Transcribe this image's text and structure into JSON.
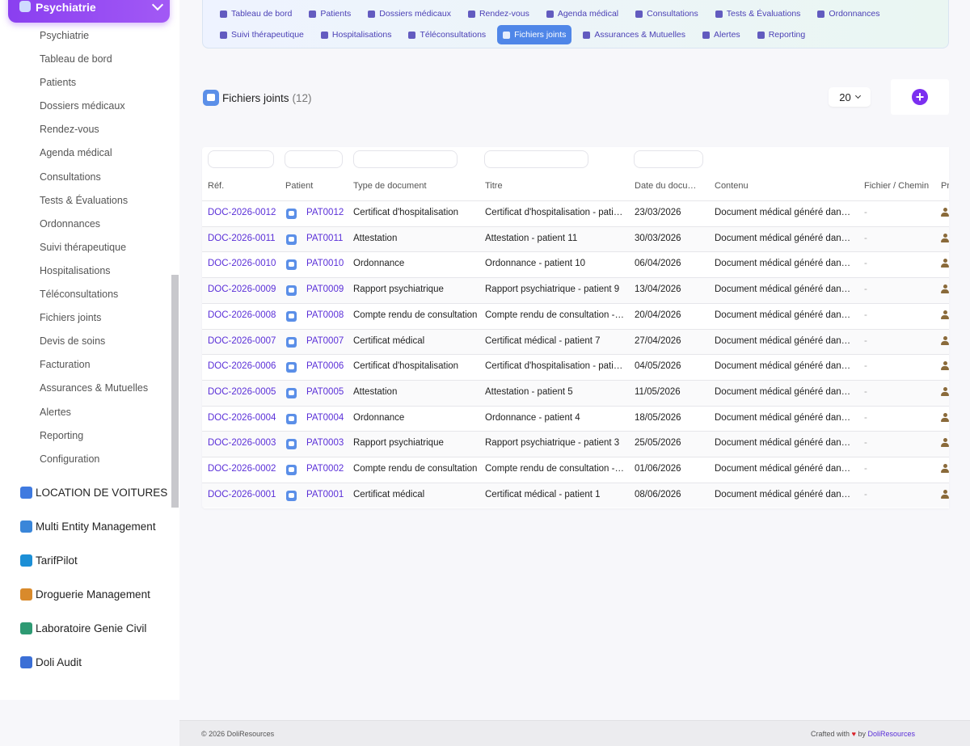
{
  "sidebar": {
    "module_title": "Psychiatrie",
    "items": [
      "Psychiatrie",
      "Tableau de bord",
      "Patients",
      "Dossiers médicaux",
      "Rendez-vous",
      "Agenda médical",
      "Consultations",
      "Tests & Évaluations",
      "Ordonnances",
      "Suivi thérapeutique",
      "Hospitalisations",
      "Téléconsultations",
      "Fichiers joints",
      "Devis de soins",
      "Facturation",
      "Assurances & Mutuelles",
      "Alertes",
      "Reporting",
      "Configuration"
    ],
    "other_modules": [
      {
        "label": "LOCATION DE VOITURES",
        "color": "#3f7ae0"
      },
      {
        "label": "Multi Entity Management",
        "color": "#3a86d9"
      },
      {
        "label": "TarifPilot",
        "color": "#1c8fd6"
      },
      {
        "label": "Droguerie Management",
        "color": "#d98a2b"
      },
      {
        "label": "Laboratoire Genie Civil",
        "color": "#2e9a73"
      },
      {
        "label": "Doli Audit",
        "color": "#3b6fd6"
      }
    ]
  },
  "topnav": {
    "row1": [
      "Tableau de bord",
      "Patients",
      "Dossiers médicaux",
      "Rendez-vous",
      "Agenda médical",
      "Consultations",
      "Tests & Évaluations",
      "Ordonnances"
    ],
    "row2": [
      "Suivi thérapeutique",
      "Hospitalisations",
      "Téléconsultations",
      "Fichiers joints",
      "Assurances & Mutuelles",
      "Alertes",
      "Reporting"
    ],
    "active": "Fichiers joints"
  },
  "page": {
    "title": "Fichiers joints",
    "count": "(12)",
    "per_page": "20"
  },
  "table": {
    "columns": [
      "Réf.",
      "Patient",
      "Type de document",
      "Titre",
      "Date du docu…",
      "Contenu",
      "Fichier / Chemin",
      "Pr"
    ],
    "rows": [
      {
        "ref": "DOC-2026-0012",
        "patient": "PAT0012",
        "type": "Certificat d'hospitalisation",
        "title": "Certificat d'hospitalisation - patie…",
        "date": "23/03/2026",
        "content": "Document médical généré dans…",
        "file": "-"
      },
      {
        "ref": "DOC-2026-0011",
        "patient": "PAT0011",
        "type": "Attestation",
        "title": "Attestation - patient 11",
        "date": "30/03/2026",
        "content": "Document médical généré dans…",
        "file": "-"
      },
      {
        "ref": "DOC-2026-0010",
        "patient": "PAT0010",
        "type": "Ordonnance",
        "title": "Ordonnance - patient 10",
        "date": "06/04/2026",
        "content": "Document médical généré dans…",
        "file": "-"
      },
      {
        "ref": "DOC-2026-0009",
        "patient": "PAT0009",
        "type": "Rapport psychiatrique",
        "title": "Rapport psychiatrique - patient 9",
        "date": "13/04/2026",
        "content": "Document médical généré dans…",
        "file": "-"
      },
      {
        "ref": "DOC-2026-0008",
        "patient": "PAT0008",
        "type": "Compte rendu de consultation",
        "title": "Compte rendu de consultation - …",
        "date": "20/04/2026",
        "content": "Document médical généré dans…",
        "file": "-"
      },
      {
        "ref": "DOC-2026-0007",
        "patient": "PAT0007",
        "type": "Certificat médical",
        "title": "Certificat médical - patient 7",
        "date": "27/04/2026",
        "content": "Document médical généré dans…",
        "file": "-"
      },
      {
        "ref": "DOC-2026-0006",
        "patient": "PAT0006",
        "type": "Certificat d'hospitalisation",
        "title": "Certificat d'hospitalisation - patie…",
        "date": "04/05/2026",
        "content": "Document médical généré dans…",
        "file": "-"
      },
      {
        "ref": "DOC-2026-0005",
        "patient": "PAT0005",
        "type": "Attestation",
        "title": "Attestation - patient 5",
        "date": "11/05/2026",
        "content": "Document médical généré dans…",
        "file": "-"
      },
      {
        "ref": "DOC-2026-0004",
        "patient": "PAT0004",
        "type": "Ordonnance",
        "title": "Ordonnance - patient 4",
        "date": "18/05/2026",
        "content": "Document médical généré dans…",
        "file": "-"
      },
      {
        "ref": "DOC-2026-0003",
        "patient": "PAT0003",
        "type": "Rapport psychiatrique",
        "title": "Rapport psychiatrique - patient 3",
        "date": "25/05/2026",
        "content": "Document médical généré dans…",
        "file": "-"
      },
      {
        "ref": "DOC-2026-0002",
        "patient": "PAT0002",
        "type": "Compte rendu de consultation",
        "title": "Compte rendu de consultation - …",
        "date": "01/06/2026",
        "content": "Document médical généré dans…",
        "file": "-"
      },
      {
        "ref": "DOC-2026-0001",
        "patient": "PAT0001",
        "type": "Certificat médical",
        "title": "Certificat médical - patient 1",
        "date": "08/06/2026",
        "content": "Document médical généré dans…",
        "file": "-"
      }
    ]
  },
  "footer": {
    "copyright": "© 2026 DoliResources",
    "crafted_prefix": "Crafted with",
    "heart": "♥",
    "crafted_by": "by",
    "brand": "DoliResources"
  },
  "colors": {
    "accent": "#8a3ff0",
    "link": "#5a2fd8",
    "active_tab": "#4f86e8",
    "add_button": "#7b2ff0"
  }
}
